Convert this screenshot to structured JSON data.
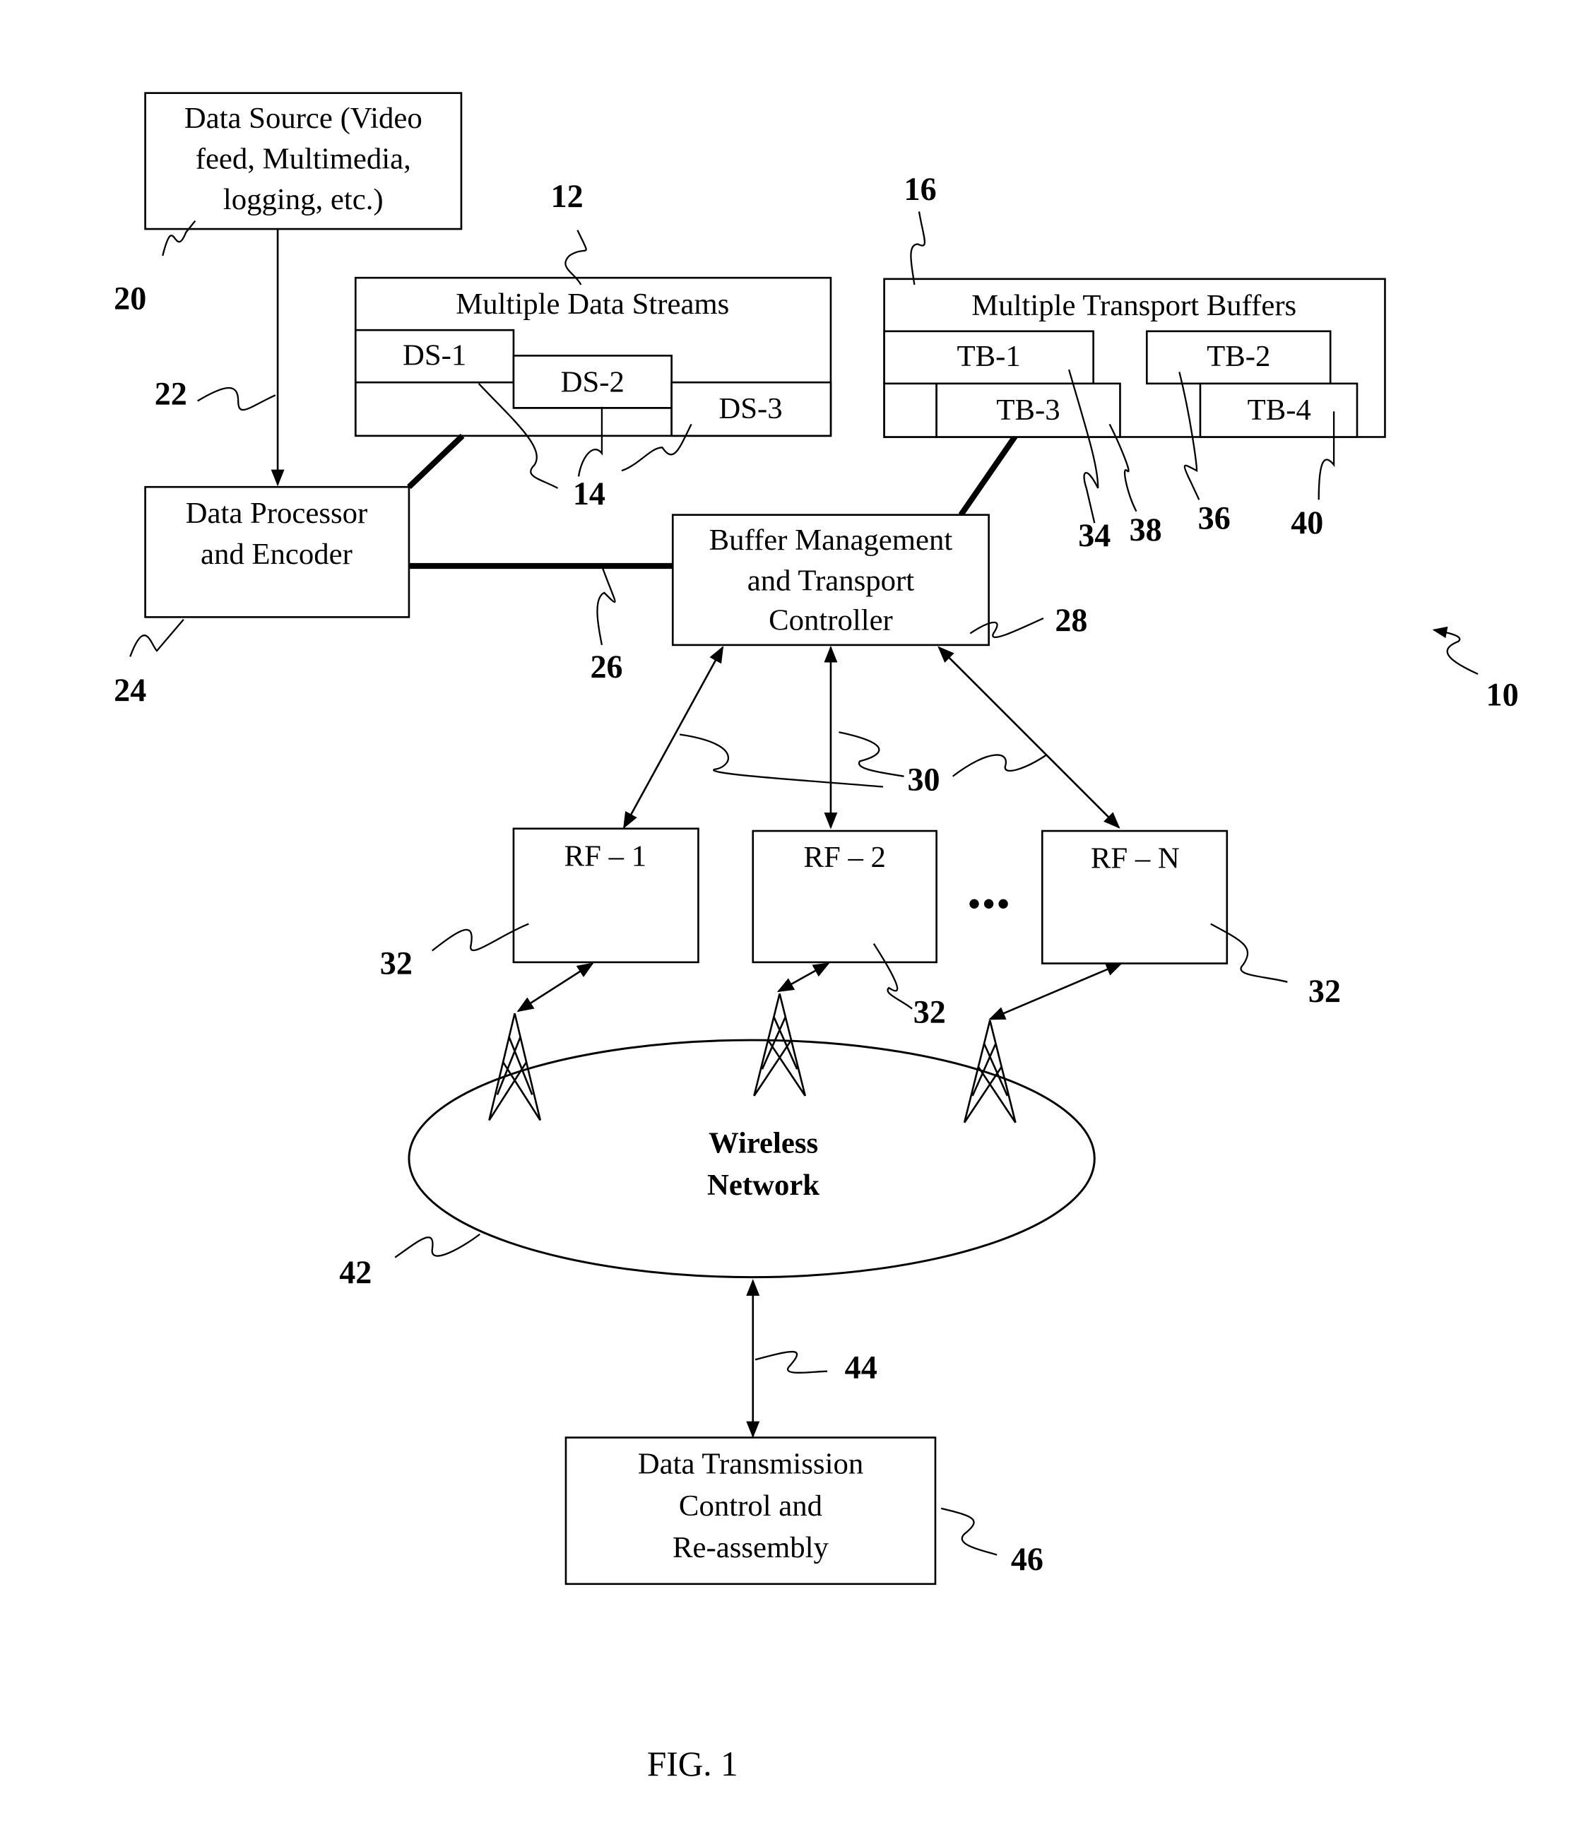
{
  "figure": {
    "caption": "FIG. 1",
    "system_ref": "10"
  },
  "data_source": {
    "lines": [
      "Data Source (Video",
      "feed, Multimedia,",
      "logging, etc.)"
    ],
    "ref": "20"
  },
  "arrow_22": {
    "ref": "22"
  },
  "data_processor": {
    "lines": [
      "Data Processor",
      "and Encoder"
    ],
    "ref": "24"
  },
  "data_streams": {
    "title": "Multiple Data Streams",
    "ref": "12",
    "streams": [
      "DS-1",
      "DS-2",
      "DS-3"
    ],
    "stream_ref": "14"
  },
  "transport_buffers": {
    "title": "Multiple Transport Buffers",
    "ref": "16",
    "buffers": [
      {
        "label": "TB-1",
        "ref": "34"
      },
      {
        "label": "TB-2",
        "ref": "36"
      },
      {
        "label": "TB-3",
        "ref": "38"
      },
      {
        "label": "TB-4",
        "ref": "40"
      }
    ]
  },
  "link_26": {
    "ref": "26"
  },
  "controller": {
    "lines": [
      "Buffer Management",
      "and Transport",
      "Controller"
    ],
    "ref": "28"
  },
  "links_30": {
    "ref": "30"
  },
  "rf_modules": {
    "items": [
      "RF – 1",
      "RF – 2",
      "RF – N"
    ],
    "ellipsis": "•••",
    "ref": "32"
  },
  "wireless_network": {
    "lines": [
      "Wireless",
      "Network"
    ],
    "ref": "42"
  },
  "link_44": {
    "ref": "44"
  },
  "receiver": {
    "lines": [
      "Data Transmission",
      "Control and",
      "Re-assembly"
    ],
    "ref": "46"
  }
}
